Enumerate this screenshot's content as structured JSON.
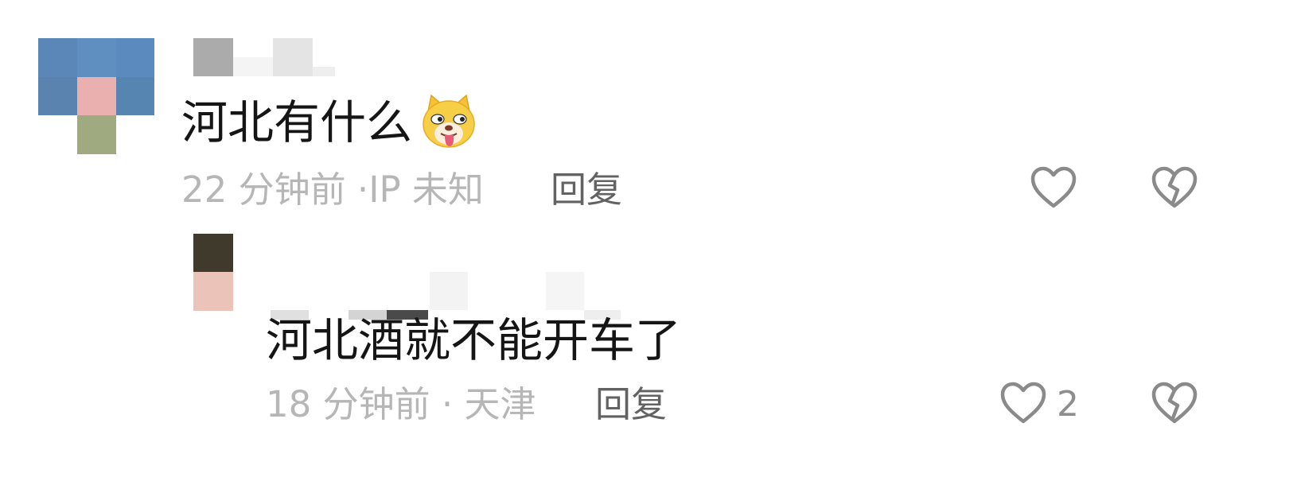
{
  "comments": [
    {
      "text": "河北有什么",
      "emoji": "doge-tongue-emoji",
      "time": "22 分钟前",
      "separator": "·",
      "location": "IP 未知",
      "reply_label": "回复",
      "like_count": ""
    },
    {
      "text": "河北酒就不能开车了",
      "time": "18 分钟前",
      "separator": "·",
      "location": "天津",
      "reply_label": "回复",
      "like_count": "2"
    }
  ],
  "icons": {
    "like": "heart-outline-icon",
    "dislike": "broken-heart-icon"
  },
  "colors": {
    "text_primary": "#151515",
    "text_meta": "#b6b6b6",
    "reply": "#626262",
    "icon_stroke": "#8a8a8a"
  }
}
